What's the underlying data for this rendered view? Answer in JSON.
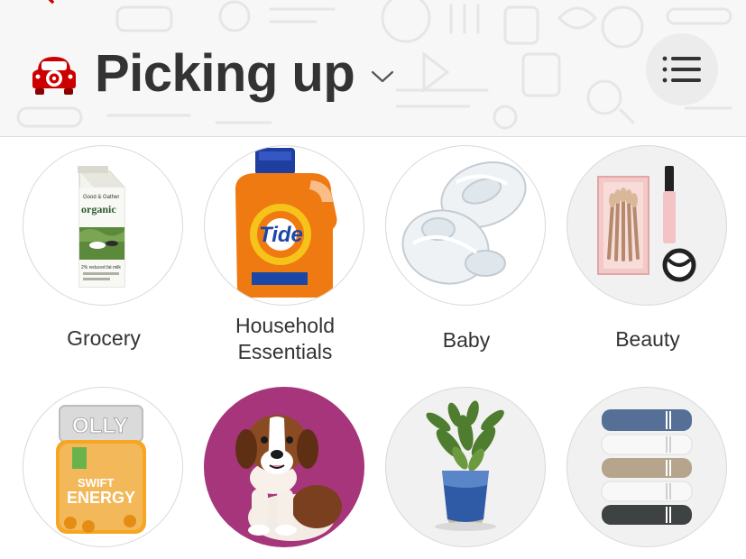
{
  "header": {
    "mode_title": "Picking up",
    "car_icon": "pickup-car-icon",
    "chevron_icon": "chevron-down-icon",
    "menu_icon": "menu-list-icon",
    "back_icon": "back-arrow-icon",
    "accent_color": "#cc0000"
  },
  "categories": [
    {
      "label": "Grocery",
      "icon": "milk-carton-image",
      "carton_brand": "Good & Gather",
      "carton_title": "organic",
      "carton_sub": "2% reduced fat milk"
    },
    {
      "label": "Household\nEssentials",
      "icon": "detergent-bottle-image",
      "bottle_brand": "Tide"
    },
    {
      "label": "Baby",
      "icon": "pacifier-image"
    },
    {
      "label": "Beauty",
      "icon": "makeup-brushes-image"
    },
    {
      "label": "",
      "icon": "vitamin-jar-image",
      "jar_brand": "OLLY",
      "jar_line1": "SWIFT",
      "jar_line2": "ENERGY"
    },
    {
      "label": "",
      "icon": "puppy-image"
    },
    {
      "label": "",
      "icon": "potted-plant-image"
    },
    {
      "label": "",
      "icon": "folded-towels-image"
    }
  ]
}
